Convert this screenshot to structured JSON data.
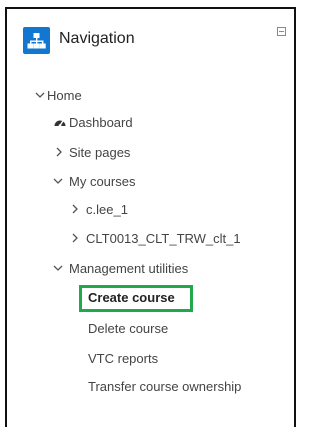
{
  "panel": {
    "title": "Navigation"
  },
  "tree": {
    "home": "Home",
    "dashboard": "Dashboard",
    "site_pages": "Site pages",
    "my_courses": "My courses",
    "course_1": "c.lee_1",
    "course_2": "CLT0013_CLT_TRW_clt_1",
    "management_utilities": "Management utilities",
    "create_course": "Create course",
    "delete_course": "Delete course",
    "vtc_reports": "VTC reports",
    "transfer_ownership": "Transfer course ownership"
  },
  "colors": {
    "nav_badge": "#1177d1",
    "highlight": "#1fa84c"
  }
}
